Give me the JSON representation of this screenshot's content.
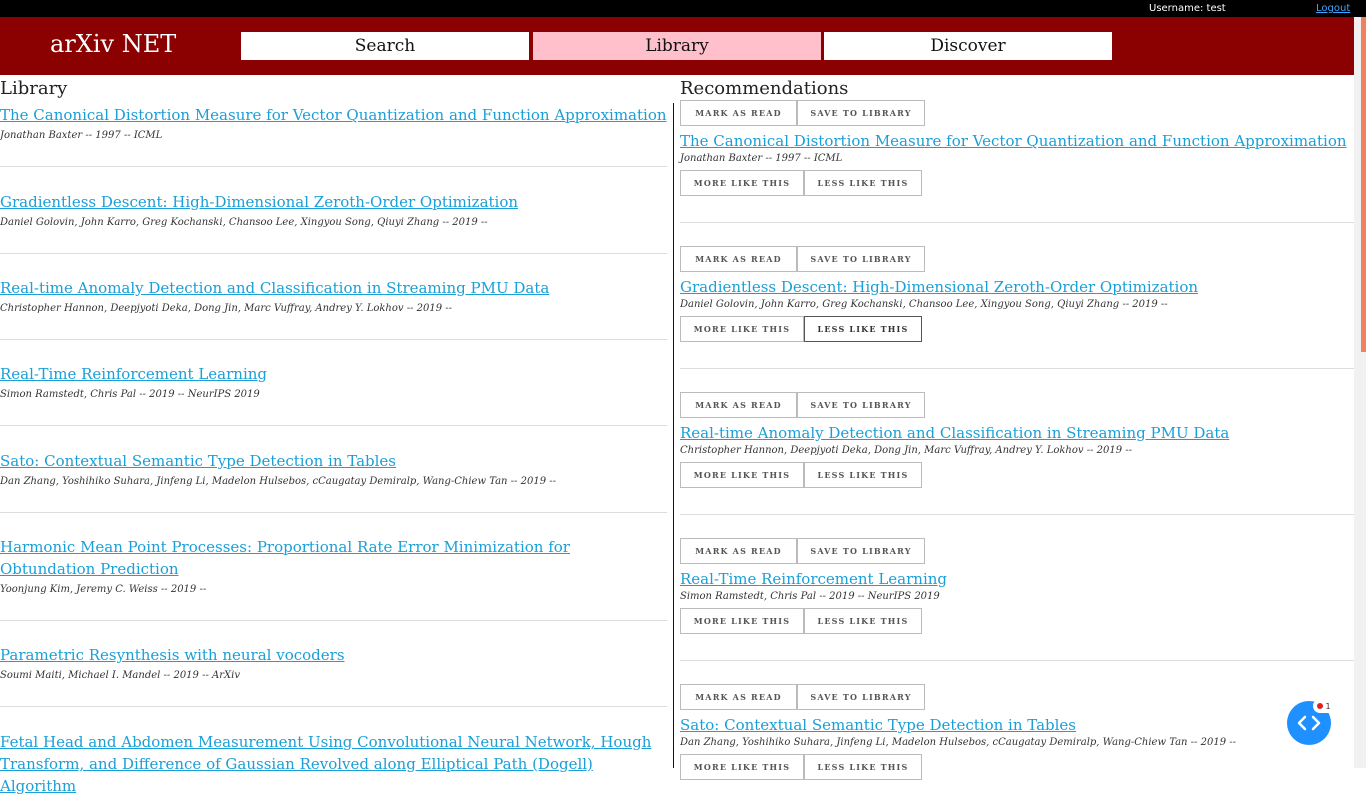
{
  "topbar": {
    "username": "Username: test",
    "logout": "Logout"
  },
  "header": {
    "brand": "arXiv NET",
    "tabs": [
      {
        "label": "Search"
      },
      {
        "label": "Library"
      },
      {
        "label": "Discover"
      }
    ]
  },
  "library": {
    "heading": "Library",
    "items": [
      {
        "title": "The Canonical Distortion Measure for Vector Quantization and Function Approximation",
        "meta": "Jonathan Baxter -- 1997 -- ICML"
      },
      {
        "title": "Gradientless Descent: High-Dimensional Zeroth-Order Optimization",
        "meta": "Daniel Golovin, John Karro, Greg Kochanski, Chansoo Lee, Xingyou Song, Qiuyi Zhang -- 2019 --"
      },
      {
        "title": "Real-time Anomaly Detection and Classification in Streaming PMU Data",
        "meta": "Christopher Hannon, Deepjyoti Deka, Dong Jin, Marc Vuffray, Andrey Y. Lokhov -- 2019 --"
      },
      {
        "title": "Real-Time Reinforcement Learning",
        "meta": "Simon Ramstedt, Chris Pal -- 2019 -- NeurIPS 2019"
      },
      {
        "title": "Sato: Contextual Semantic Type Detection in Tables",
        "meta": "Dan Zhang, Yoshihiko Suhara, Jinfeng Li, Madelon Hulsebos, cCaugatay Demiralp, Wang-Chiew Tan -- 2019 --"
      },
      {
        "title": "Harmonic Mean Point Processes: Proportional Rate Error Minimization for Obtundation Prediction",
        "meta": "Yoonjung Kim, Jeremy C. Weiss -- 2019 --"
      },
      {
        "title": "Parametric Resynthesis with neural vocoders",
        "meta": "Soumi Maiti, Michael I. Mandel -- 2019 -- ArXiv"
      },
      {
        "title": "Fetal Head and Abdomen Measurement Using Convolutional Neural Network, Hough Transform, and Difference of Gaussian Revolved along Elliptical Path (Dogell) Algorithm",
        "meta": ""
      }
    ]
  },
  "recommendations": {
    "heading": "Recommendations",
    "buttons": {
      "mark_read": "MARK AS READ",
      "save": "SAVE TO LIBRARY",
      "more": "MORE LIKE THIS",
      "less": "LESS LIKE THIS"
    },
    "items": [
      {
        "title": "The Canonical Distortion Measure for Vector Quantization and Function Approximation",
        "meta": "Jonathan Baxter -- 1997 -- ICML"
      },
      {
        "title": "Gradientless Descent: High-Dimensional Zeroth-Order Optimization",
        "meta": "Daniel Golovin, John Karro, Greg Kochanski, Chansoo Lee, Xingyou Song, Qiuyi Zhang -- 2019 --"
      },
      {
        "title": "Real-time Anomaly Detection and Classification in Streaming PMU Data",
        "meta": "Christopher Hannon, Deepjyoti Deka, Dong Jin, Marc Vuffray, Andrey Y. Lokhov -- 2019 --"
      },
      {
        "title": "Real-Time Reinforcement Learning",
        "meta": "Simon Ramstedt, Chris Pal -- 2019 -- NeurIPS 2019"
      },
      {
        "title": "Sato: Contextual Semantic Type Detection in Tables",
        "meta": "Dan Zhang, Yoshihiko Suhara, Jinfeng Li, Madelon Hulsebos, cCaugatay Demiralp, Wang-Chiew Tan -- 2019 --"
      }
    ]
  },
  "widget": {
    "badge": "1",
    "icon": "code-icon"
  },
  "colors": {
    "header": "#8b0000",
    "active_tab": "#ffc0cb",
    "link": "#1a9fd8",
    "fab": "#1e90ff"
  }
}
